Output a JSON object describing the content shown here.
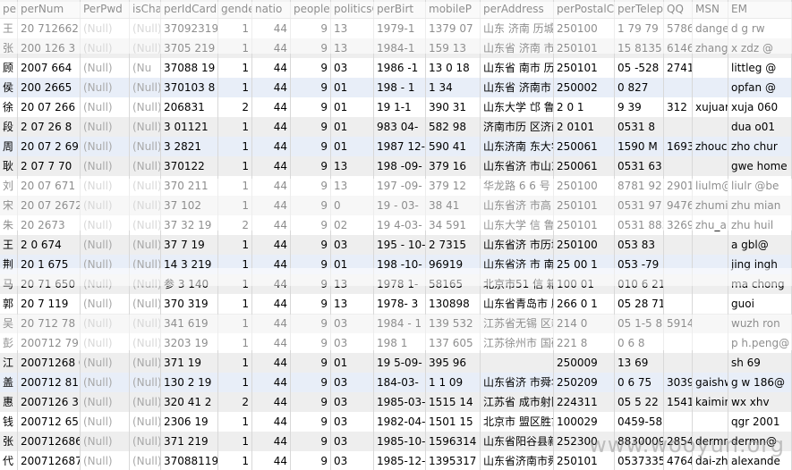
{
  "columns": [
    "pe",
    "perNum",
    "PerPwd",
    "isCha",
    "perIdCard",
    "gende",
    "natio",
    "peopleI",
    "politicsC",
    "perBirt",
    "mobileP",
    "perAddress",
    "perPostalC",
    "perTelep",
    "QQ",
    "MSN",
    "EM"
  ],
  "rows": [
    [
      "王",
      "20 712662",
      "(Null)",
      "(Null)",
      "37092319",
      "1",
      "44",
      "9",
      "13",
      "1979-1",
      "1379 07",
      "山东 济南 历城",
      "250100",
      "1 79 79",
      "5786",
      "dange",
      "d g rw"
    ],
    [
      "张",
      "200 126 3",
      "(Null)",
      "(Null)",
      "3705 219",
      "1",
      "44",
      "9",
      "13",
      "1984-1",
      "159 13",
      "山东省 济南 市 驿",
      "250101",
      "15 8135",
      "6146",
      "zhang",
      "x zdz @"
    ],
    [
      "顾",
      "2007 664",
      "(Null)",
      "(Nu",
      "37088 19",
      "1",
      "44",
      "9",
      "03",
      "1986 -1",
      "13 0 18",
      "山东省 南市 历",
      "250101",
      "05 -528",
      "2741",
      "",
      "littleg @"
    ],
    [
      "侯",
      "200 2665",
      "(Null)",
      "(Null)",
      "370103 8",
      "1",
      "44",
      "9",
      "01",
      "198 - 1",
      "1 34",
      "山东省 济南市 中",
      "250002",
      "0 827",
      "",
      "",
      "opfan @"
    ],
    [
      "徐",
      "20 07 266",
      "(Null)",
      "(Null)",
      "206831",
      "2",
      "44",
      "9",
      "01",
      "19 1-1",
      "390 31",
      "山东大学 邙 鲁软件",
      "2 0 1",
      "9 39",
      "312",
      "xujuan",
      "xuja 060"
    ],
    [
      "段",
      "2 07 26 8",
      "(Null)",
      "(Null)",
      "3 01121",
      "1",
      "44",
      "9",
      "01",
      "983 04-",
      "582 98",
      "济南市历 区济南",
      "2 0101",
      "0531 8",
      "",
      "",
      "dua o01"
    ],
    [
      "周",
      "20 07 2 69",
      "(Null)",
      "(Null)",
      "3 2821",
      "1",
      "44",
      "9",
      "01",
      "1987 12-",
      "590 41",
      "山东济南 东大学",
      "250061",
      "1590 M",
      "1693",
      "zhouch",
      "zho chur"
    ],
    [
      "耿",
      "2 07 7 70",
      "(Null)",
      "(Null)",
      "370122",
      "1",
      "44",
      "9",
      "13",
      "198 -09-",
      "379 16",
      "山东省济 市山东",
      "250061",
      "0531 63",
      "",
      "",
      "gwe home"
    ],
    [
      "刘",
      "20 07 671",
      "(Null)",
      "(Null)",
      "370 211",
      "1",
      "44",
      "9",
      "13",
      "197 -09-",
      "379 12",
      "华龙路 6 6 号",
      "250100",
      "8781 92",
      "2901",
      "liulm@",
      "liulr @be"
    ],
    [
      "宋",
      "20 07 2672",
      "(Null)",
      "(Null)",
      "37 102",
      "1",
      "44",
      "9",
      "0",
      "19 - 03-",
      "38 41",
      "山东省济 市高",
      "250101",
      "0531 97",
      "9476",
      "zhumian",
      "zhu mian"
    ],
    [
      "朱",
      "20 2673",
      "(Null)",
      "(Null)",
      "37 32 19",
      "2",
      "44",
      "9",
      "02",
      "19 4-03-",
      "34 591",
      "山东大学 信 鲁软件",
      "250101",
      "0531 883",
      "3269",
      "zhu_ar",
      "zhu huil"
    ],
    [
      "王",
      "2 0 674",
      "(Null)",
      "(Null)",
      "37 7 19",
      "1",
      "44",
      "9",
      "03",
      "195 - 10-",
      "2 7315",
      "山东省济 市历城",
      "250100",
      "053 83",
      "",
      "",
      "a gbl@"
    ],
    [
      "荆",
      "20 1 675",
      "(Null)",
      "(Null)",
      "14 3 219",
      "1",
      "44",
      "9",
      "01",
      "198 -10-",
      "96919",
      "山东省济 市 南",
      "25 00 1",
      "053 -79",
      "",
      "",
      "jing ingh"
    ],
    [
      "马",
      "20 71 650",
      "(Null)",
      "(Null)",
      "参 3 140",
      "1",
      "44",
      "9",
      "13",
      "1978 1-",
      "58165",
      "北京市51 信 箱",
      "100 01",
      "010 6 21",
      "",
      "",
      "ma chong"
    ],
    [
      "郭",
      "20 7 119",
      "(Null)",
      "(Null)",
      "370 319",
      "1",
      "44",
      "9",
      "13",
      "1978- 3",
      "130898",
      "山东省青岛市 胶",
      "266 0 1",
      "05 28 71",
      "",
      "",
      "guoi"
    ],
    [
      "吴",
      "20 712 78",
      "(Null)",
      "(Null)",
      "341 619",
      "1",
      "44",
      "9",
      "03",
      "1984 - 1",
      "139 532",
      "江苏省无锡 区新",
      "214 0",
      "05 1-5 8",
      "5914",
      "",
      "wuzh ron"
    ],
    [
      "彭",
      "200712 79",
      "(Null)",
      "(Null)",
      "3203 19",
      "1",
      "44",
      "9",
      "03",
      "198 1",
      "137 605",
      "江苏徐州市 国矿",
      "221 8",
      "0 6 8",
      "",
      "",
      "p h.peng@"
    ],
    [
      "江",
      "20071268 0",
      "(Null)",
      "(Null)",
      "371 19",
      "1",
      "44",
      "9",
      "01",
      "19 5-09-",
      "395 96",
      "",
      "250009",
      "13 69",
      "",
      "",
      "sh 69"
    ],
    [
      "盖",
      "200712 81",
      "(Null)",
      "(Null)",
      "130 2 19",
      "1",
      "44",
      "9",
      "03",
      "184-03-",
      "1 1 09",
      "山东省济 市舜华",
      "250209",
      "0 6 75",
      "3039",
      "gaishw",
      "g w 186@"
    ],
    [
      "惠",
      "2007126 3",
      "(Null)",
      "(Null)",
      "320 41 2",
      "2",
      "44",
      "9",
      "03",
      "1985-03-",
      "1515 14",
      "江苏省 成市射阳",
      "224311",
      "05 5 22",
      "1541",
      "kaimin",
      "wx xhv"
    ],
    [
      "钱",
      "200712 65",
      "(Null)",
      "(Null)",
      "2306 19",
      "1",
      "44",
      "9",
      "03",
      "1982-04-",
      "1501 15",
      "北京市 盟区胜古",
      "100029",
      "0459-581",
      "",
      "",
      "qgr 2001"
    ],
    [
      "张",
      "200712686",
      "(Null)",
      "(Null)",
      "371 219",
      "1",
      "44",
      "9",
      "03",
      "1985-10-",
      "1596314",
      "山东省阳谷县新华",
      "252300",
      "8830009",
      "2854",
      "dermn",
      "dermn@"
    ],
    [
      "代",
      "200712687",
      "(Null)",
      "(Null)",
      "37088119",
      "1",
      "44",
      "9",
      "03",
      "1985-12-",
      "1395317",
      "山东省济南市舜华",
      "250101",
      "05373356",
      "4764",
      "dai-zh",
      "alexande"
    ]
  ],
  "watermark": "www.wooyun.org"
}
